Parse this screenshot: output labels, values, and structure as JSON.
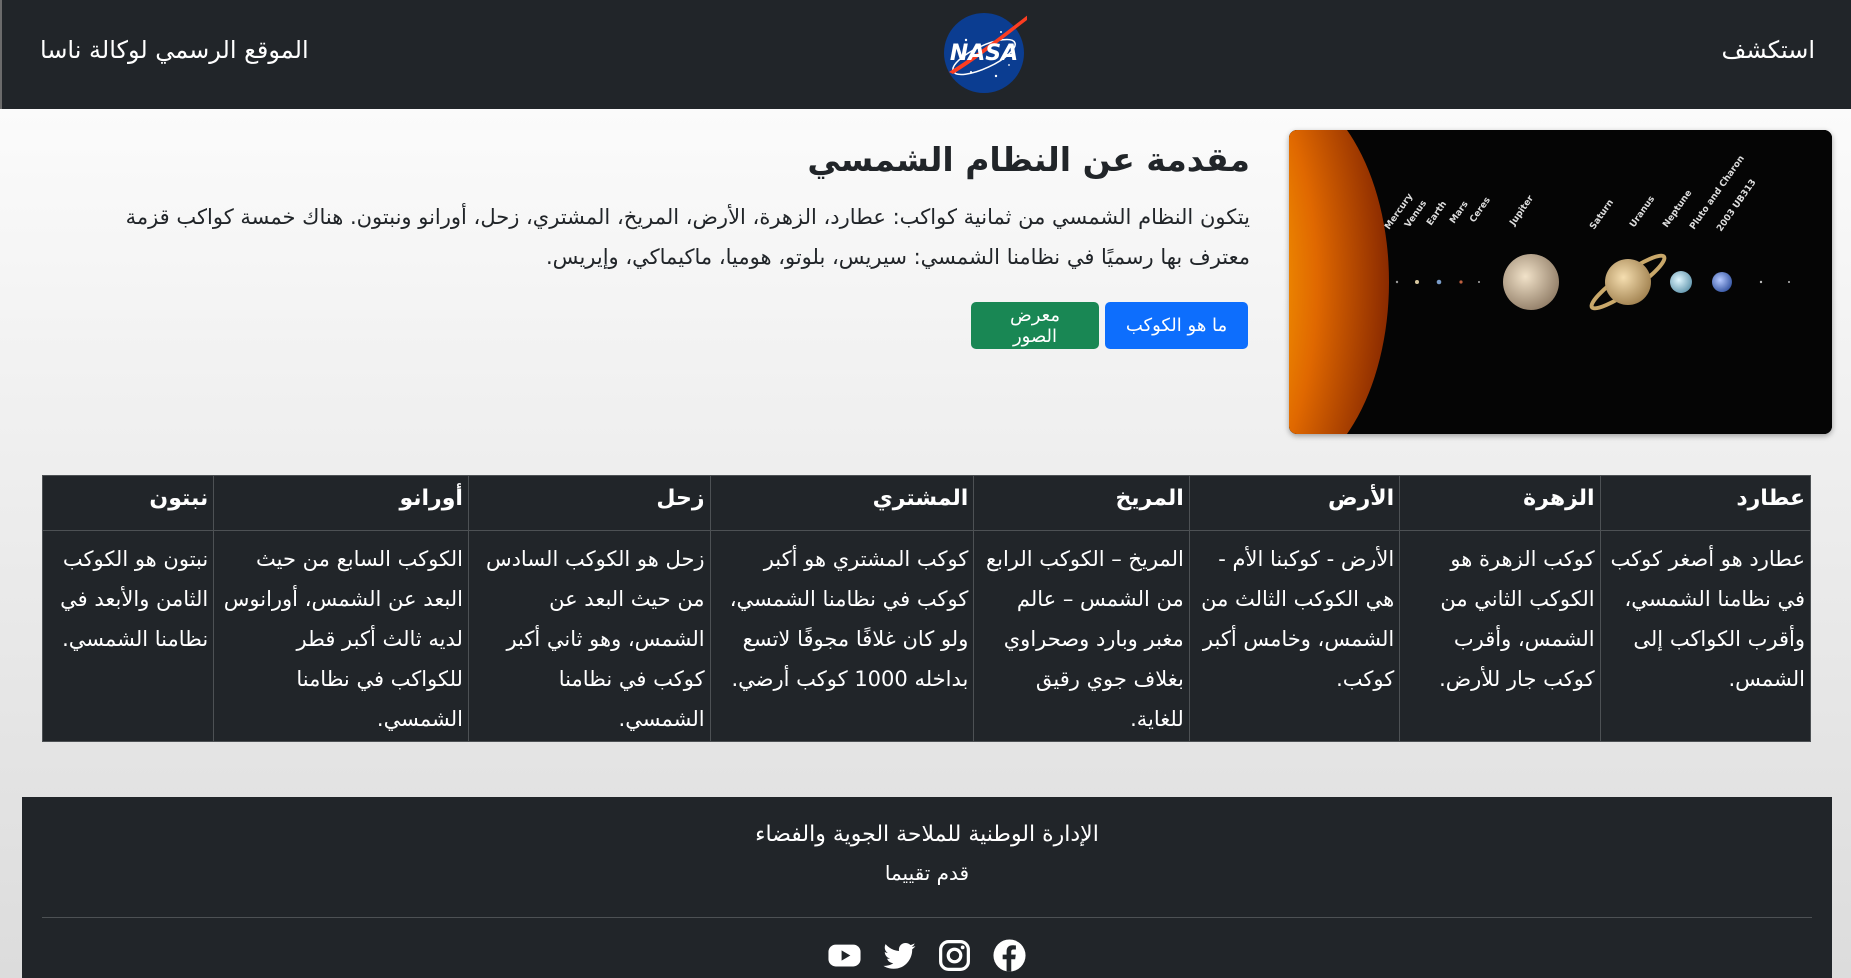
{
  "navbar": {
    "left_text": "الموقع الرسمي لوكالة ناسا",
    "right_text": "استكشف",
    "logo_text": "NASA"
  },
  "hero": {
    "title": "مقدمة عن النظام الشمسي",
    "description": "يتكون النظام الشمسي من ثمانية كواكب: عطارد، الزهرة، الأرض، المريخ، المشتري، زحل، أورانو ونبتون. هناك خمسة كواكب قزمة معترف بها رسميًا في نظامنا الشمسي: سيريس، بلوتو، هوميا، ماكيماكي، وإيريس.",
    "btn_primary": "ما هو الكوكب",
    "btn_success": "معرض الصور",
    "image_labels": [
      "Mercury",
      "Venus",
      "Earth",
      "Mars",
      "Ceres",
      "Jupiter",
      "Saturn",
      "Uranus",
      "Neptune",
      "Pluto and Charon",
      "2003 UB313"
    ]
  },
  "table": {
    "headers": [
      "عطارد",
      "الزهرة",
      "الأرض",
      "المريخ",
      "المشتري",
      "زحل",
      "أورانو",
      "نبتون"
    ],
    "cells": [
      "عطارد هو أصغر كوكب في نظامنا الشمسي، وأقرب الكواكب إلى الشمس.",
      "كوكب الزهرة هو الكوكب الثاني من الشمس، وأقرب كوكب جار للأرض.",
      "الأرض - كوكبنا الأم - هي الكوكب الثالث من الشمس، وخامس أكبر كوكب.",
      "المريخ – الكوكب الرابع من الشمس – عالم مغبر وبارد وصحراوي بغلاف جوي رقيق للغاية.",
      "كوكب المشتري هو أكبر كوكب في نظامنا الشمسي، ولو كان غلافًا مجوفًا لاتسع بداخله 1000 كوكب أرضي.",
      "زحل هو الكوكب السادس من حيث البعد عن الشمس، وهو ثاني أكبر كوكب في نظامنا الشمسي.",
      "الكوكب السابع من حيث البعد عن الشمس، أورانوس لديه ثالث أكبر قطر للكواكب في نظامنا الشمسي.",
      "نبتون هو الكوكب الثامن والأبعد في نظامنا الشمسي."
    ]
  },
  "footer": {
    "title": "الإدارة الوطنية للملاحة الجوية والفضاء",
    "link": "قدم تقييما",
    "social": [
      "youtube-icon",
      "twitter-icon",
      "instagram-icon",
      "facebook-icon"
    ]
  },
  "colors": {
    "navbar_bg": "#212529",
    "primary": "#0d6efd",
    "success": "#198754",
    "nasa_blue": "#0b3d91",
    "nasa_red": "#fc3d21"
  }
}
